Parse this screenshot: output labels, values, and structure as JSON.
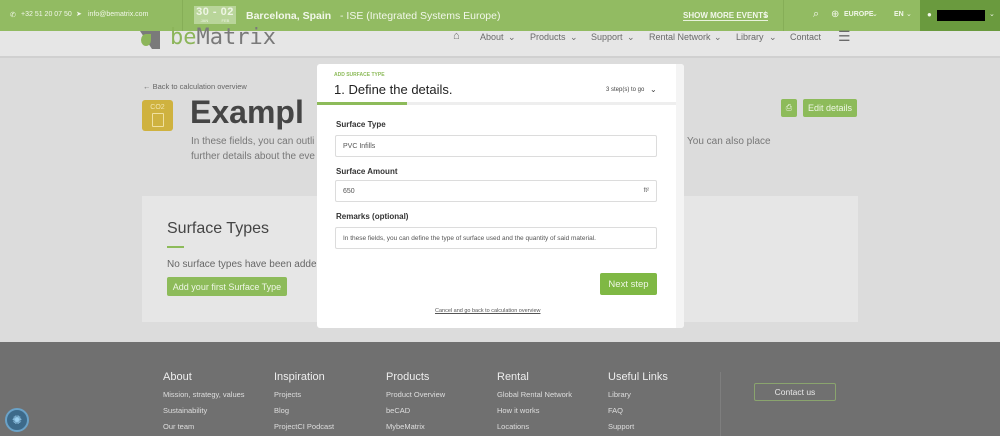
{
  "topbar": {
    "phone": "+32 51 20 07 50",
    "email": "info@bematrix.com",
    "event_day": "30",
    "event_day_end": "02",
    "event_month": "JAN",
    "event_month_end": "FEB",
    "event_city": "Barcelona, Spain",
    "event_name": " - ISE (Integrated Systems Europe)",
    "show_more": "SHOW MORE EVENTS",
    "region": "EUROPE",
    "language": "EN"
  },
  "nav": {
    "logo": "beMatrix",
    "items": [
      "About",
      "Products",
      "Support",
      "Rental Network",
      "Library",
      "Contact"
    ]
  },
  "page": {
    "back": "← Back to calculation overview",
    "title": "Exampl",
    "desc_line1": "In these fields, you can outli",
    "desc_line2": "further details about the eve",
    "desc_right": "You can also place",
    "edit_details": "Edit details",
    "co2_label": "CO2",
    "section_title": "Surface Types",
    "empty_text": "No surface types have been adde",
    "add_button": "Add your first Surface Type"
  },
  "modal": {
    "eyebrow": "ADD SURFACE TYPE",
    "title": "1. Define the details.",
    "steps": "3 step(s) to go",
    "progress_percent": 25,
    "surface_type_label": "Surface Type",
    "surface_type_value": "PVC Infills",
    "surface_amount_label": "Surface Amount",
    "surface_amount_value": "650",
    "unit": "ft²",
    "remarks_label": "Remarks (optional)",
    "remarks_value": "In these fields, you can define the type of surface used and the quantity of said material.",
    "next": "Next step",
    "cancel": "Cancel and go back to calculation overview"
  },
  "footer": {
    "columns": [
      {
        "title": "About",
        "links": [
          "Mission, strategy, values",
          "Sustainability",
          "Our team"
        ]
      },
      {
        "title": "Inspiration",
        "links": [
          "Projects",
          "Blog",
          "ProjectCI Podcast"
        ]
      },
      {
        "title": "Products",
        "links": [
          "Product Overview",
          "beCAD",
          "MybeMatrix"
        ]
      },
      {
        "title": "Rental",
        "links": [
          "Global Rental Network",
          "How it works",
          "Locations"
        ]
      },
      {
        "title": "Useful Links",
        "links": [
          "Library",
          "FAQ",
          "Support"
        ]
      }
    ],
    "contact": "Contact us"
  },
  "colors": {
    "accent": "#8dbb5a",
    "topbar": "#92bb62",
    "footer": "#707070"
  }
}
